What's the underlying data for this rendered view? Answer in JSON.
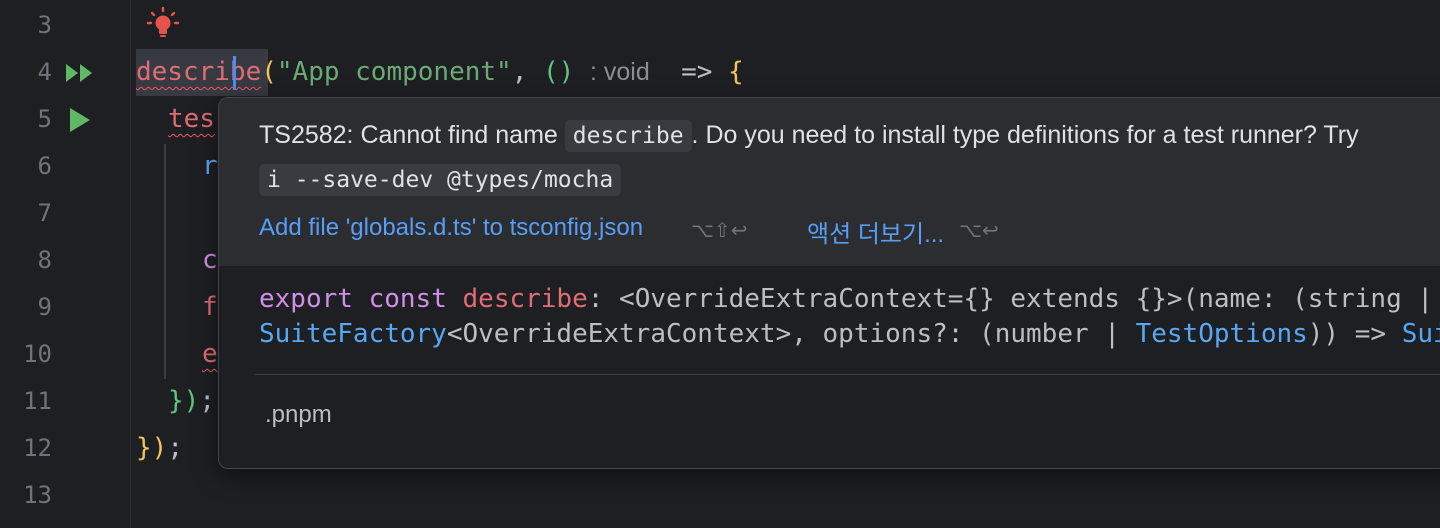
{
  "editor": {
    "line_numbers": [
      "3",
      "4",
      "5",
      "6",
      "7",
      "8",
      "9",
      "10",
      "11",
      "12",
      "13"
    ],
    "lines": {
      "l4_fn": "describe",
      "l4_open": "(",
      "l4_str": "\"App component\"",
      "l4_comma": ", ",
      "l4_arrow_parens": "()",
      "l4_hint": ": void",
      "l4_arrow": "=>",
      "l4_brace": "{",
      "l5": "tes",
      "l6": "r",
      "l8": "c",
      "l9": "f",
      "l10": "e",
      "l11_close": "})",
      "l11_semi": ";",
      "l12_close": "})",
      "l12_semi": ";"
    }
  },
  "popup": {
    "msg_prefix": "TS2582: Cannot find name",
    "msg_code": "describe",
    "msg_suffix": ". Do you need to install type definitions for a test runner? Try",
    "msg_line2_code": "i --save-dev @types/mocha",
    "action_primary": "Add file 'globals.d.ts' to tsconfig.json",
    "action_primary_shortcut": "⌥⇧↩",
    "action_more": "액션 더보기...",
    "action_more_shortcut": "⌥↩",
    "decl_line1": {
      "export": "export",
      "const": "const",
      "name": "describe",
      "rest": ": <OverrideExtraContext={} extends {}>(name: (string | Fu"
    },
    "decl_line2": {
      "type1": "SuiteFactory",
      "mid": "<OverrideExtraContext>, options?: (number | ",
      "type2": "TestOptions",
      "end": ")) => ",
      "type3": "Suite"
    },
    "doc_path": ".pnpm"
  },
  "colors": {
    "background": "#1e1f22",
    "popup_bg": "#2b2d30",
    "link": "#589df6",
    "error_squiggle": "#f75464"
  }
}
